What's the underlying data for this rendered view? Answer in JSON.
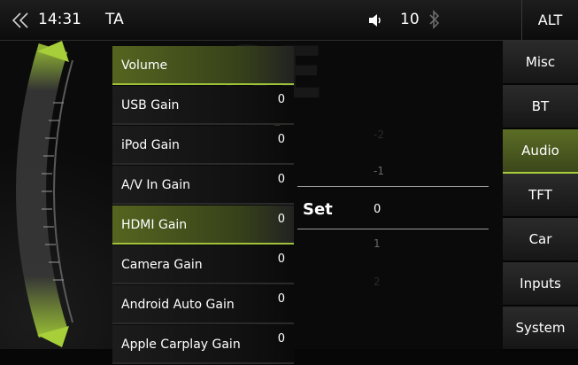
{
  "status": {
    "time": "14:31",
    "source": "TA",
    "volume": "10",
    "alt_label": "ALT"
  },
  "gains": [
    {
      "label": "Volume",
      "value": ""
    },
    {
      "label": "USB Gain",
      "value": "0"
    },
    {
      "label": "iPod Gain",
      "value": "0"
    },
    {
      "label": "A/V In Gain",
      "value": "0"
    },
    {
      "label": "HDMI Gain",
      "value": "0"
    },
    {
      "label": "Camera Gain",
      "value": "0"
    },
    {
      "label": "Android Auto Gain",
      "value": "0"
    },
    {
      "label": "Apple Carplay Gain",
      "value": "0"
    }
  ],
  "picker": {
    "set_label": "Set",
    "values": [
      "-2",
      "-1",
      "0",
      "1",
      "2"
    ],
    "current": "0"
  },
  "tabs": [
    "Misc",
    "BT",
    "Audio",
    "TFT",
    "Car",
    "Inputs",
    "System"
  ],
  "active_tab": "Audio",
  "accent_color": "#a9cc3c",
  "icons": {
    "back": "back-chevron-icon",
    "speaker": "speaker-icon",
    "bluetooth": "bluetooth-icon"
  }
}
